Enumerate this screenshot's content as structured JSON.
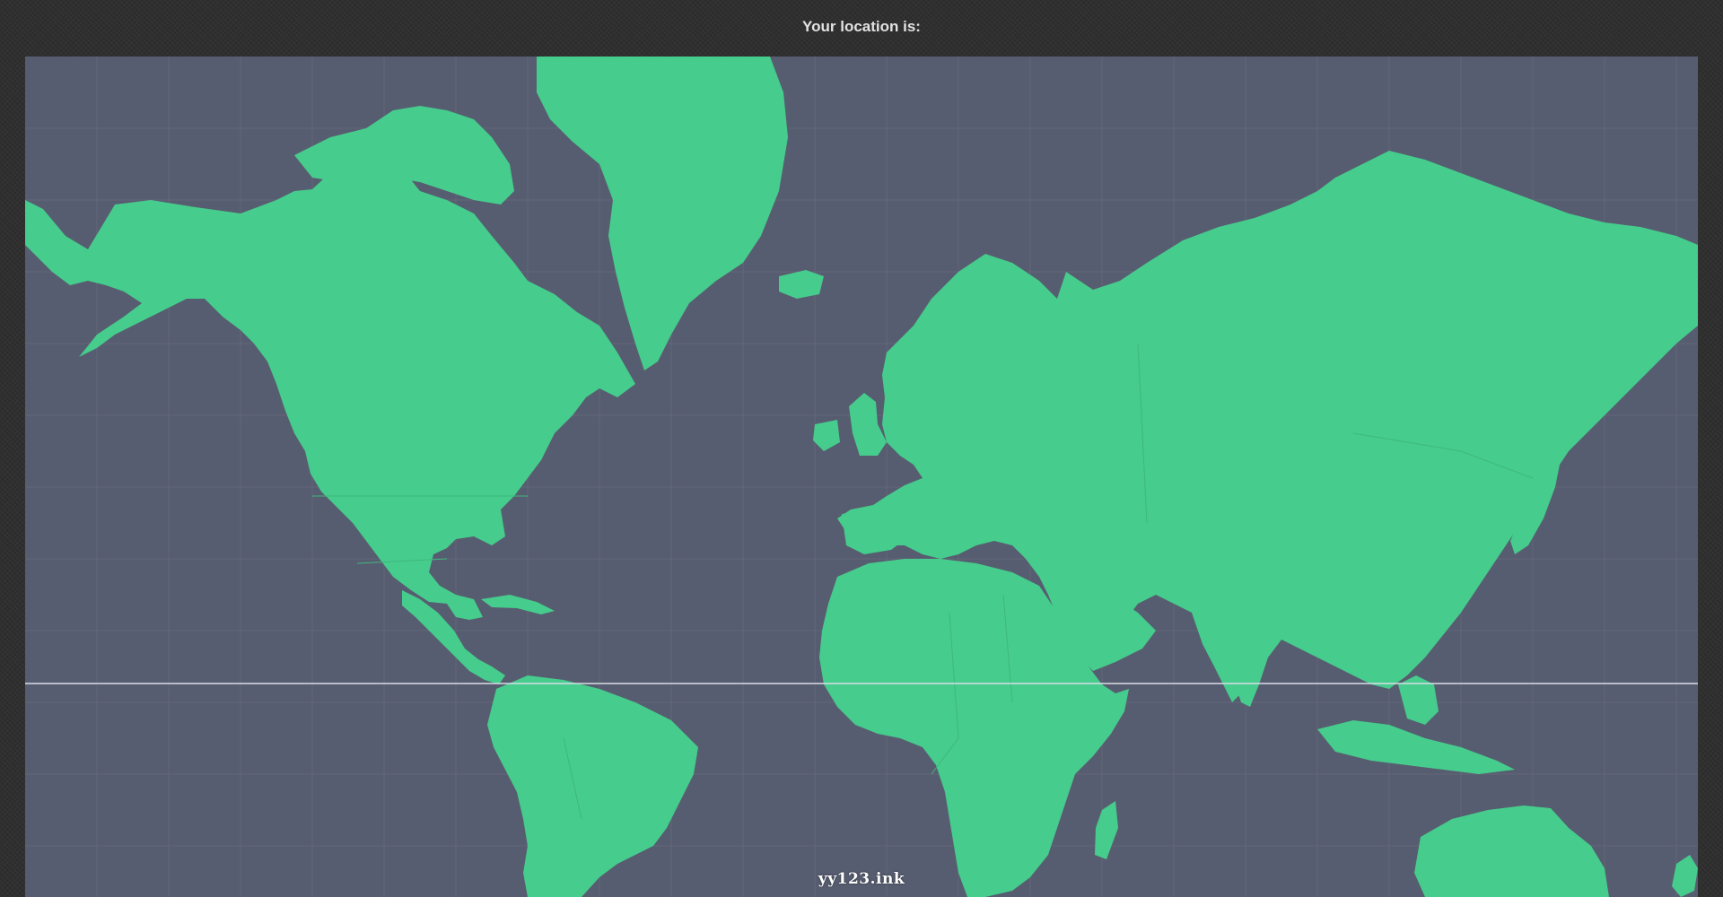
{
  "header": {
    "title": "Your location is:"
  },
  "map": {
    "projection": "mercator",
    "land_color": "#46cc8c",
    "ocean_color": "#575d70",
    "equator_color": "#d8dde6",
    "grid": true,
    "equator_line": true
  },
  "watermark": {
    "text": "yy123.ink"
  },
  "colors": {
    "page_background": "#2f2f2f",
    "header_text": "#e2e2e2"
  }
}
